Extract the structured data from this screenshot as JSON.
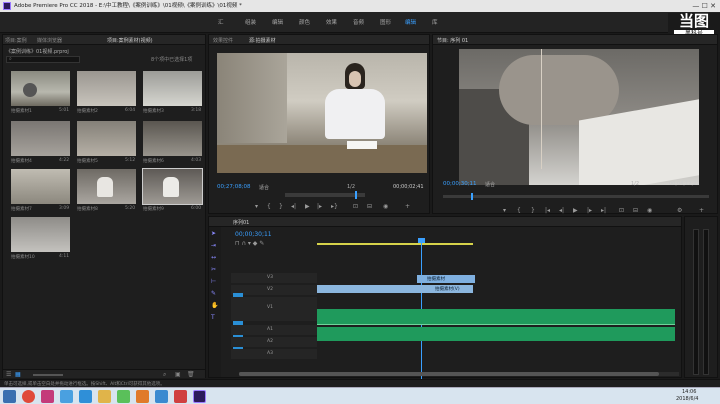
{
  "window": {
    "title": "Adobe Premiere Pro CC 2018 - E:\\中工教程\\《案例训练》\\01视频\\《案例训练》\\01视频 *"
  },
  "menu": {
    "items": [
      "汇",
      "编辑",
      "剪辑",
      "序列",
      "标记",
      "图形",
      "窗",
      "帮助",
      "学习",
      "汇",
      "组装",
      "编辑",
      "颜色",
      "效果",
      "音频",
      "图形",
      "库"
    ]
  },
  "workspace": {
    "active": "编辑"
  },
  "logo": {
    "text": "当图",
    "sub": "黑科号",
    "number": "8138828"
  },
  "project_panel": {
    "tabs": [
      "项目:案例",
      "媒体浏览器",
      "项目:案例素材(视频)",
      "效果",
      "标记"
    ],
    "path": "《案例训练》01视频.prproj",
    "item_count": "8个项中已选择1项",
    "clips": [
      {
        "name": "拍摄素材1",
        "duration": "5:01"
      },
      {
        "name": "拍摄素材2",
        "duration": "6:04"
      },
      {
        "name": "拍摄素材3",
        "duration": "3:18"
      },
      {
        "name": "拍摄素材4",
        "duration": "4:22"
      },
      {
        "name": "拍摄素材5",
        "duration": "5:12"
      },
      {
        "name": "拍摄素材6",
        "duration": "4:03"
      },
      {
        "name": "拍摄素材7",
        "duration": "3:09"
      },
      {
        "name": "拍摄素材8",
        "duration": "5:20"
      },
      {
        "name": "拍摄素材9",
        "duration": "6:00"
      },
      {
        "name": "拍摄素材10",
        "duration": "4:11"
      }
    ]
  },
  "source_monitor": {
    "tabs": [
      "效果控件",
      "源:拍摄素材"
    ],
    "timecode": "00;27;08;08",
    "fit": "适合",
    "scale": "1/2",
    "duration": "00;00;02;41"
  },
  "program_monitor": {
    "tab": "节目: 序列 01",
    "timecode": "00;00;30;11",
    "fit": "适合",
    "scale": "1/2",
    "duration": "00;04;12;22"
  },
  "timeline": {
    "tab": "序列01",
    "timecode": "00;00;30;11",
    "tracks": [
      "V3",
      "V2",
      "V1",
      "A1",
      "A2",
      "A3"
    ],
    "clip_v2": "拍摄素材",
    "clip_v1": "拍摄素材(V)"
  },
  "status_bar": {
    "text": "单击可选择,或单击空白处并拖动进行框选。按Shift、Alt和Ctrl可获得其他选项。"
  },
  "taskbar": {
    "time": "14:06",
    "date": "2018/6/4"
  }
}
